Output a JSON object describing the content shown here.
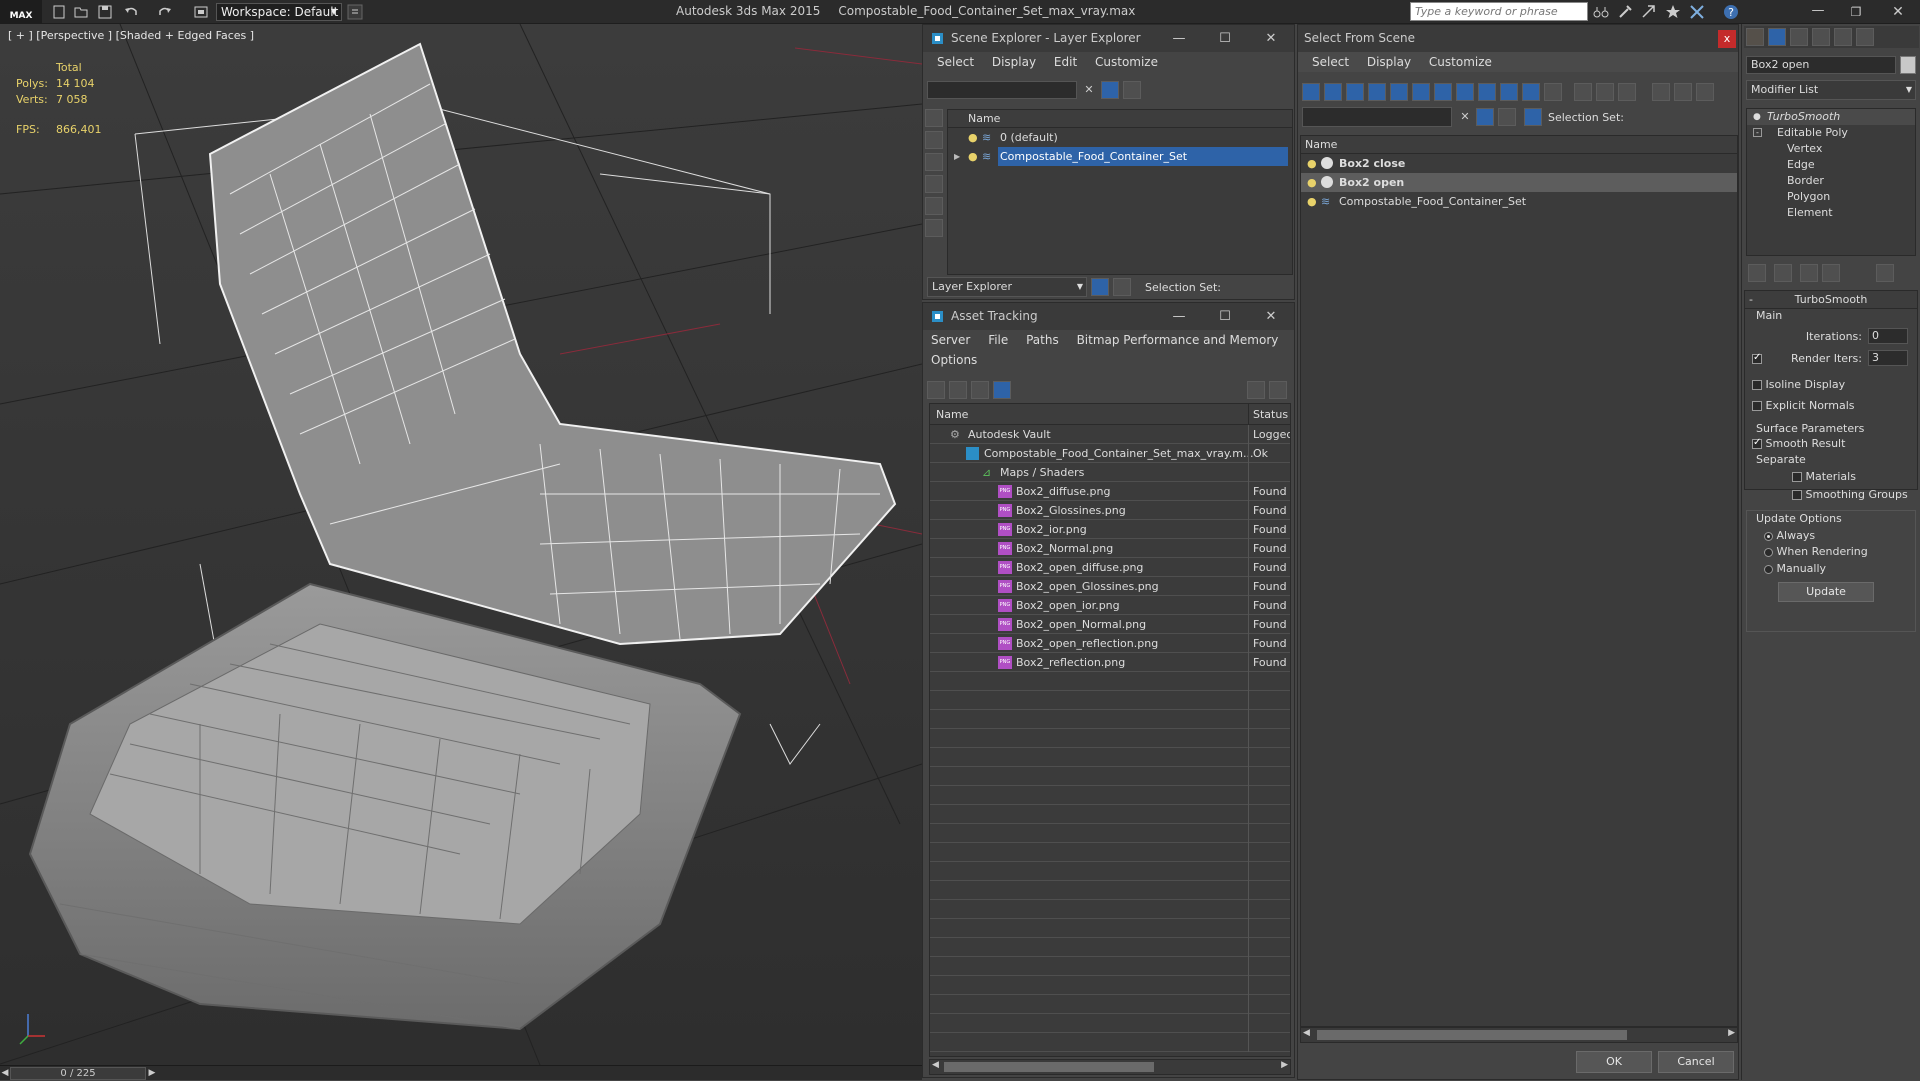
{
  "app": {
    "title": "Autodesk 3ds Max  2015",
    "filename": "Compostable_Food_Container_Set_max_vray.max",
    "logo": "MAX",
    "workspace_label": "Workspace: Default",
    "search_placeholder": "Type a keyword or phrase"
  },
  "viewport": {
    "label": "[ + ] [Perspective ] [Shaded + Edged Faces ]",
    "stats": {
      "total_label": "Total",
      "polys_label": "Polys:",
      "polys_value": "14 104",
      "verts_label": "Verts:",
      "verts_value": "7 058",
      "fps_label": "FPS:",
      "fps_value": "866,401"
    }
  },
  "timeline": {
    "slider": "0 / 225"
  },
  "scene_explorer": {
    "title": "Scene Explorer - Layer Explorer",
    "menu": [
      "Select",
      "Display",
      "Edit",
      "Customize"
    ],
    "column": "Name",
    "layers": [
      {
        "name": "0 (default)",
        "selected": false
      },
      {
        "name": "Compostable_Food_Container_Set",
        "selected": true
      }
    ],
    "footer_dropdown": "Layer Explorer",
    "footer_selection_set": "Selection Set:"
  },
  "asset_tracking": {
    "title": "Asset Tracking",
    "menu": [
      "Server",
      "File",
      "Paths",
      "Bitmap Performance and Memory"
    ],
    "menu2": [
      "Options"
    ],
    "col_name": "Name",
    "col_status": "Status",
    "rows": [
      {
        "name": "Autodesk Vault",
        "status": "Logged",
        "indent": 0,
        "icon": "vault"
      },
      {
        "name": "Compostable_Food_Container_Set_max_vray.m...",
        "status": "Ok",
        "indent": 1,
        "icon": "max"
      },
      {
        "name": "Maps / Shaders",
        "status": "",
        "indent": 2,
        "icon": "maps"
      },
      {
        "name": "Box2_diffuse.png",
        "status": "Found",
        "indent": 3,
        "icon": "png"
      },
      {
        "name": "Box2_Glossines.png",
        "status": "Found",
        "indent": 3,
        "icon": "png"
      },
      {
        "name": "Box2_ior.png",
        "status": "Found",
        "indent": 3,
        "icon": "png"
      },
      {
        "name": "Box2_Normal.png",
        "status": "Found",
        "indent": 3,
        "icon": "png"
      },
      {
        "name": "Box2_open_diffuse.png",
        "status": "Found",
        "indent": 3,
        "icon": "png"
      },
      {
        "name": "Box2_open_Glossines.png",
        "status": "Found",
        "indent": 3,
        "icon": "png"
      },
      {
        "name": "Box2_open_ior.png",
        "status": "Found",
        "indent": 3,
        "icon": "png"
      },
      {
        "name": "Box2_open_Normal.png",
        "status": "Found",
        "indent": 3,
        "icon": "png"
      },
      {
        "name": "Box2_open_reflection.png",
        "status": "Found",
        "indent": 3,
        "icon": "png"
      },
      {
        "name": "Box2_reflection.png",
        "status": "Found",
        "indent": 3,
        "icon": "png"
      }
    ],
    "png_badge": "PNG"
  },
  "select_from_scene": {
    "title": "Select From Scene",
    "menu": [
      "Select",
      "Display",
      "Customize"
    ],
    "selection_set_label": "Selection Set:",
    "column": "Name",
    "items": [
      {
        "name": "Box2 close",
        "bold": true,
        "selected": false
      },
      {
        "name": "Box2 open",
        "bold": true,
        "selected": true
      },
      {
        "name": "Compostable_Food_Container_Set",
        "bold": false,
        "selected": false
      }
    ],
    "ok": "OK",
    "cancel": "Cancel"
  },
  "command_panel": {
    "object_name": "Box2 open",
    "modifier_list": "Modifier List",
    "stack": [
      {
        "name": "TurboSmooth",
        "italic": true,
        "indent": 0
      },
      {
        "name": "Editable Poly",
        "italic": false,
        "indent": 1
      },
      {
        "name": "Vertex",
        "italic": false,
        "indent": 2
      },
      {
        "name": "Edge",
        "italic": false,
        "indent": 2
      },
      {
        "name": "Border",
        "italic": false,
        "indent": 2
      },
      {
        "name": "Polygon",
        "italic": false,
        "indent": 2
      },
      {
        "name": "Element",
        "italic": false,
        "indent": 2
      }
    ],
    "rollout_title": "TurboSmooth",
    "rollout_collapse": "-",
    "main_label": "Main",
    "iterations_label": "Iterations:",
    "iterations_value": "0",
    "render_iters_label": "Render Iters:",
    "render_iters_value": "3",
    "isoline_display": "Isoline Display",
    "explicit_normals": "Explicit Normals",
    "surface_params_label": "Surface Parameters",
    "smooth_result": "Smooth Result",
    "separate_label": "Separate",
    "materials": "Materials",
    "smoothing_groups": "Smoothing Groups",
    "update_options_label": "Update Options",
    "always": "Always",
    "when_rendering": "When Rendering",
    "manually": "Manually",
    "update_button": "Update"
  },
  "colors": {
    "accent_blue": "#2e63a8",
    "stats_yellow": "#e8d26a",
    "close_red": "#c42b2b",
    "png_purple": "#b04fc4"
  }
}
